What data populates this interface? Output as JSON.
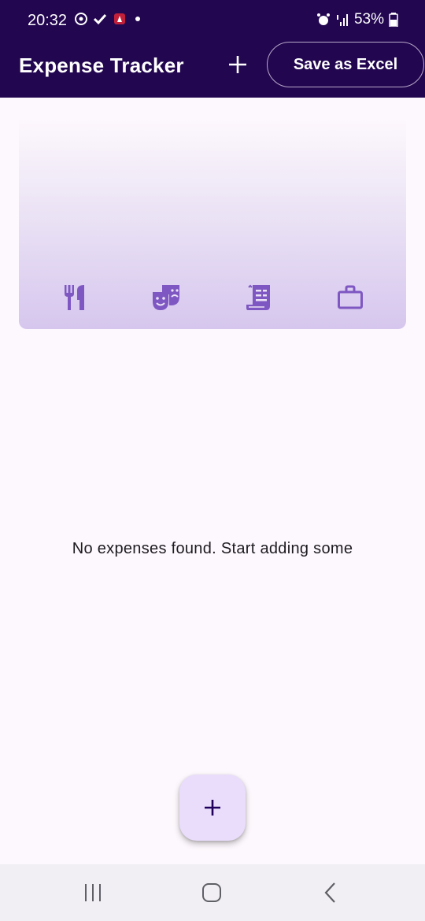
{
  "status_bar": {
    "time": "20:32",
    "battery": "53%"
  },
  "app_bar": {
    "title": "Expense Tracker",
    "add_icon": "plus-icon",
    "save_label": "Save as Excel"
  },
  "chart": {
    "categories": [
      {
        "icon": "fork-knife-icon"
      },
      {
        "icon": "theater-masks-icon"
      },
      {
        "icon": "receipt-icon"
      },
      {
        "icon": "briefcase-icon"
      }
    ]
  },
  "main": {
    "empty_message": "No expenses found. Start adding some"
  },
  "fab": {
    "icon": "plus-icon"
  },
  "nav": {
    "recents_icon": "recents-icon",
    "home_icon": "home-icon",
    "back_icon": "back-icon"
  },
  "colors": {
    "app_bar": "#220650",
    "background": "#fdf8fd",
    "category_icon": "#7e57c2",
    "fab_bg": "#e9ddfb",
    "fab_icon": "#21005d"
  }
}
